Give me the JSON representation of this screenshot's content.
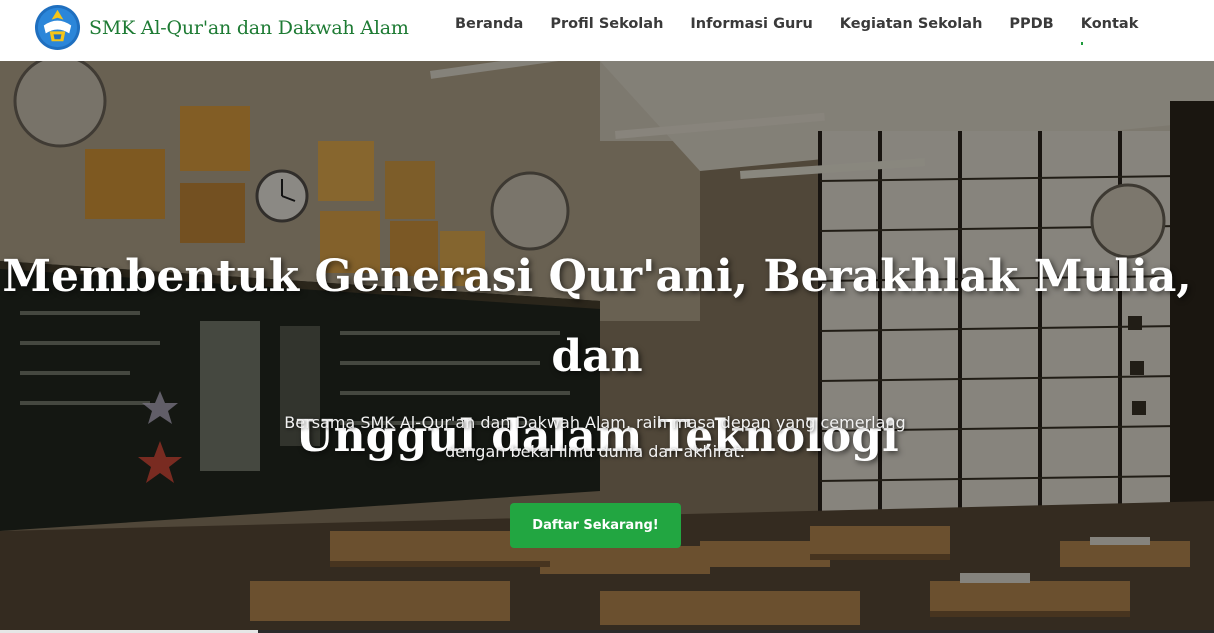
{
  "brand": {
    "name": "SMK Al-Qur'an dan Dakwah Alam",
    "logo_icon": "tut-wuri-handayani-logo"
  },
  "nav": {
    "items": [
      {
        "label": "Beranda"
      },
      {
        "label": "Profil Sekolah"
      },
      {
        "label": "Informasi Guru"
      },
      {
        "label": "Kegiatan Sekolah"
      },
      {
        "label": "PPDB"
      },
      {
        "label": "Kontak"
      }
    ],
    "active_index": 5
  },
  "hero": {
    "title_line1": "Membentuk Generasi Qur'ani, Berakhlak Mulia, dan",
    "title_line2": "Unggul dalam Teknologi",
    "subtitle_line1": "Bersama SMK Al-Qur'an dan Dakwah Alam, raih masa depan yang cemerlang",
    "subtitle_line2": "dengan bekal ilmu dunia dan akhirat.",
    "cta_label": "Daftar Sekarang!",
    "background": "classroom-photo"
  },
  "colors": {
    "brand_green": "#1e7b34",
    "cta_green": "#22a641",
    "nav_text": "#3a3a3a",
    "hero_text": "#ffffff"
  }
}
